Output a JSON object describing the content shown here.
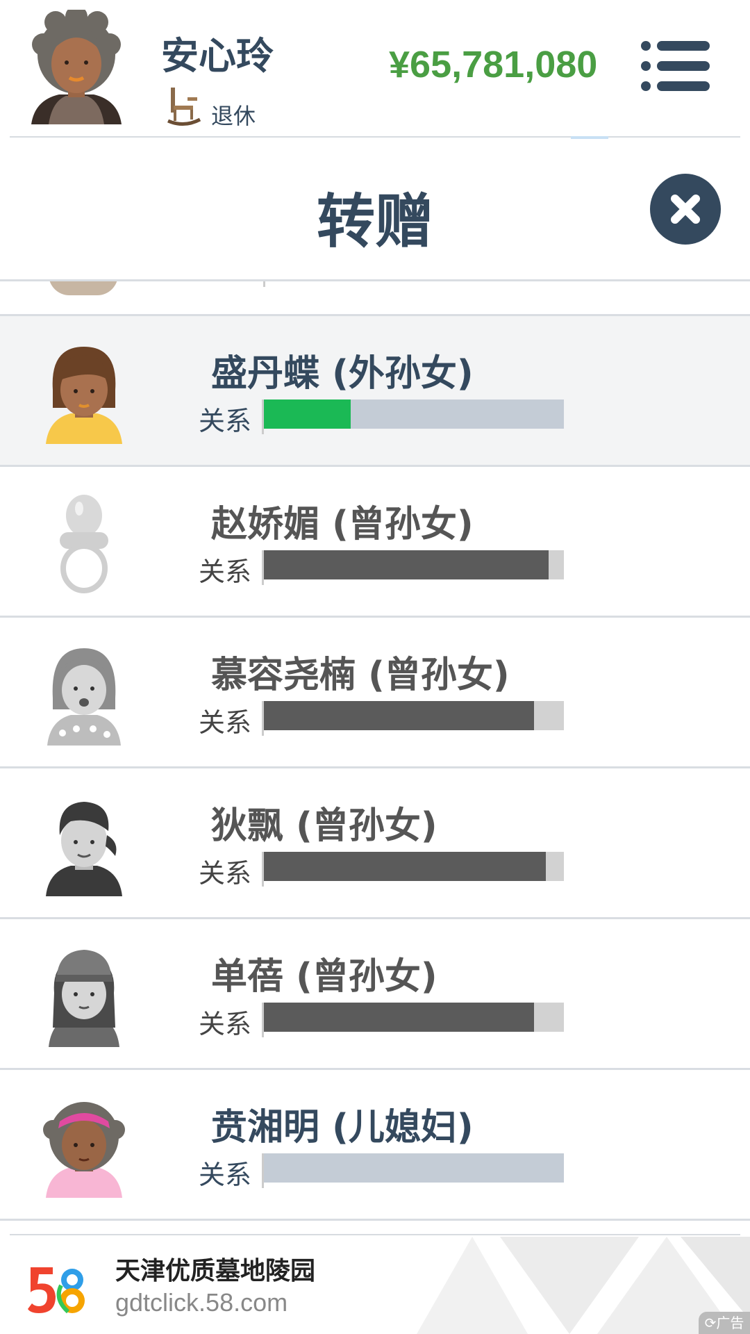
{
  "player": {
    "name": "安心玲",
    "status": "退休",
    "money": "¥65,781,080"
  },
  "icons": {
    "menu": "menu-icon",
    "close": "close-icon",
    "status": "rocking-chair-icon"
  },
  "modal": {
    "title": "转赠"
  },
  "relation_label": "关系",
  "people": [
    {
      "name": "盛丹蝶 (外孙女)",
      "relation": 0.29,
      "bar_color": "#1bb955",
      "selected": true,
      "muted": false
    },
    {
      "name": "赵娇媚 (曾孙女)",
      "relation": 0.95,
      "bar_color": "#5b5b5b",
      "selected": false,
      "muted": true
    },
    {
      "name": "慕容尧楠 (曾孙女)",
      "relation": 0.9,
      "bar_color": "#5b5b5b",
      "selected": false,
      "muted": true
    },
    {
      "name": "狄飘 (曾孙女)",
      "relation": 0.94,
      "bar_color": "#5b5b5b",
      "selected": false,
      "muted": true
    },
    {
      "name": "单蓓 (曾孙女)",
      "relation": 0.9,
      "bar_color": "#5b5b5b",
      "selected": false,
      "muted": true
    },
    {
      "name": "贲湘明 (儿媳妇)",
      "relation": 0.0,
      "bar_color": "#5b5b5b",
      "selected": false,
      "muted": false
    }
  ],
  "ad": {
    "title": "天津优质墓地陵园",
    "url": "gdtclick.58.com",
    "badge": "广告"
  },
  "colors": {
    "primary": "#34495e",
    "money": "#4a9e43",
    "relation_good": "#1bb955",
    "relation_track": "#c4ccd6"
  }
}
